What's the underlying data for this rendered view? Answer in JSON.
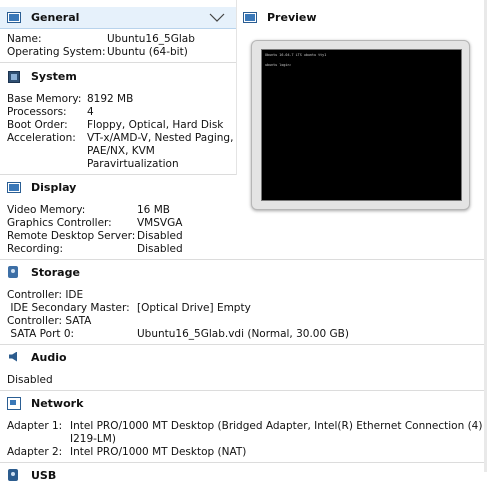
{
  "general": {
    "title": "General",
    "rows": [
      {
        "label": "Name:",
        "value": "Ubuntu16_5Glab"
      },
      {
        "label": "Operating System:",
        "value": "Ubuntu (64-bit)"
      }
    ]
  },
  "preview": {
    "title": "Preview",
    "screen_lines": [
      "Ubuntu 16.04.7 LTS ubuntu tty1",
      "",
      "ubuntu login:"
    ]
  },
  "system": {
    "title": "System",
    "rows": [
      {
        "label": "Base Memory:",
        "value": "8192 MB"
      },
      {
        "label": "Processors:",
        "value": "4"
      },
      {
        "label": "Boot Order:",
        "value": "Floppy, Optical, Hard Disk"
      },
      {
        "label": "Acceleration:",
        "value_lines": [
          "VT-x/AMD-V, Nested Paging,",
          "PAE/NX, KVM",
          "Paravirtualization"
        ]
      }
    ]
  },
  "display": {
    "title": "Display",
    "rows": [
      {
        "label": "Video Memory:",
        "value": "16 MB"
      },
      {
        "label": "Graphics Controller:",
        "value": "VMSVGA"
      },
      {
        "label": "Remote Desktop Server:",
        "value": "Disabled"
      },
      {
        "label": "Recording:",
        "value": "Disabled"
      }
    ]
  },
  "storage": {
    "title": "Storage",
    "rows": [
      {
        "label": "Controller: IDE",
        "value": ""
      },
      {
        "label": " IDE Secondary Master:",
        "value": "[Optical Drive] Empty"
      },
      {
        "label": "Controller: SATA",
        "value": ""
      },
      {
        "label": " SATA Port 0:",
        "value": "Ubuntu16_5Glab.vdi (Normal, 30.00 GB)"
      }
    ]
  },
  "audio": {
    "title": "Audio",
    "status": "Disabled"
  },
  "network": {
    "title": "Network",
    "rows": [
      {
        "label": "Adapter 1:",
        "value_lines": [
          "Intel PRO/1000 MT Desktop (Bridged Adapter, Intel(R) Ethernet Connection (4)",
          "I219-LM)"
        ]
      },
      {
        "label": "Adapter 2:",
        "value": "Intel PRO/1000 MT Desktop (NAT)"
      }
    ]
  },
  "usb": {
    "title": "USB"
  },
  "icons": {
    "general": "monitor-icon",
    "preview": "monitor-icon",
    "system": "chip-icon",
    "display": "monitor-icon",
    "storage": "disk-icon",
    "audio": "speaker-icon",
    "network": "network-icon",
    "usb": "usb-icon",
    "collapse": "chevron-down-icon"
  },
  "colors": {
    "selected_header": "#e6f1fb",
    "icon_blue": "#3a78b8",
    "preview_screen": "#000000"
  }
}
